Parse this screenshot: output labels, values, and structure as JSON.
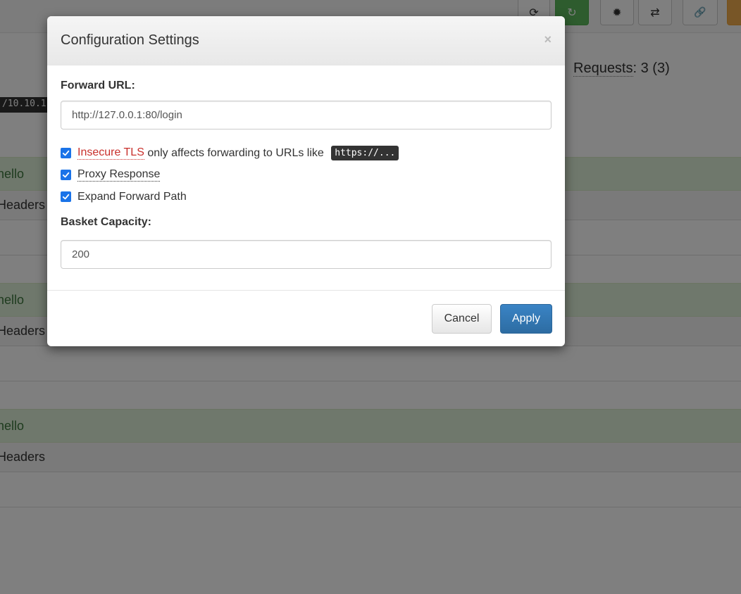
{
  "background": {
    "toolbar": {
      "buttons": [
        {
          "name": "refresh-button",
          "glyph": "⟳"
        },
        {
          "name": "auto-refresh-button",
          "glyph": "↻"
        },
        {
          "name": "settings-button",
          "glyph": "✹"
        },
        {
          "name": "swap-button",
          "glyph": "⇄"
        },
        {
          "name": "link-button",
          "glyph": "🔗"
        },
        {
          "name": "extra-button",
          "glyph": ""
        }
      ]
    },
    "requests": {
      "label": "Requests",
      "count": ": 3 (3)"
    },
    "client_ip": "/10.10.1",
    "request_items": [
      {
        "title": "hello",
        "headers_label": "Headers"
      },
      {
        "title": "hello",
        "headers_label": "Headers"
      },
      {
        "title": "hello",
        "headers_label": "Headers"
      }
    ]
  },
  "modal": {
    "title": "Configuration Settings",
    "close_glyph": "×",
    "forward_url": {
      "label": "Forward URL:",
      "value": "http://127.0.0.1:80/login"
    },
    "insecure_tls": {
      "checked": true,
      "link_text": "Insecure TLS",
      "text": " only affects forwarding to URLs like ",
      "code": "https://..."
    },
    "proxy_response": {
      "checked": true,
      "label": "Proxy Response"
    },
    "expand_forward_path": {
      "checked": true,
      "label": "Expand Forward Path"
    },
    "basket_capacity": {
      "label": "Basket Capacity:",
      "value": "200"
    },
    "cancel_label": "Cancel",
    "apply_label": "Apply"
  },
  "colors": {
    "primary": "#337ab7",
    "success": "#5cb85c",
    "warning": "#f0ad4e",
    "danger_text": "#c9302c",
    "checkbox": "#1a73e8"
  }
}
